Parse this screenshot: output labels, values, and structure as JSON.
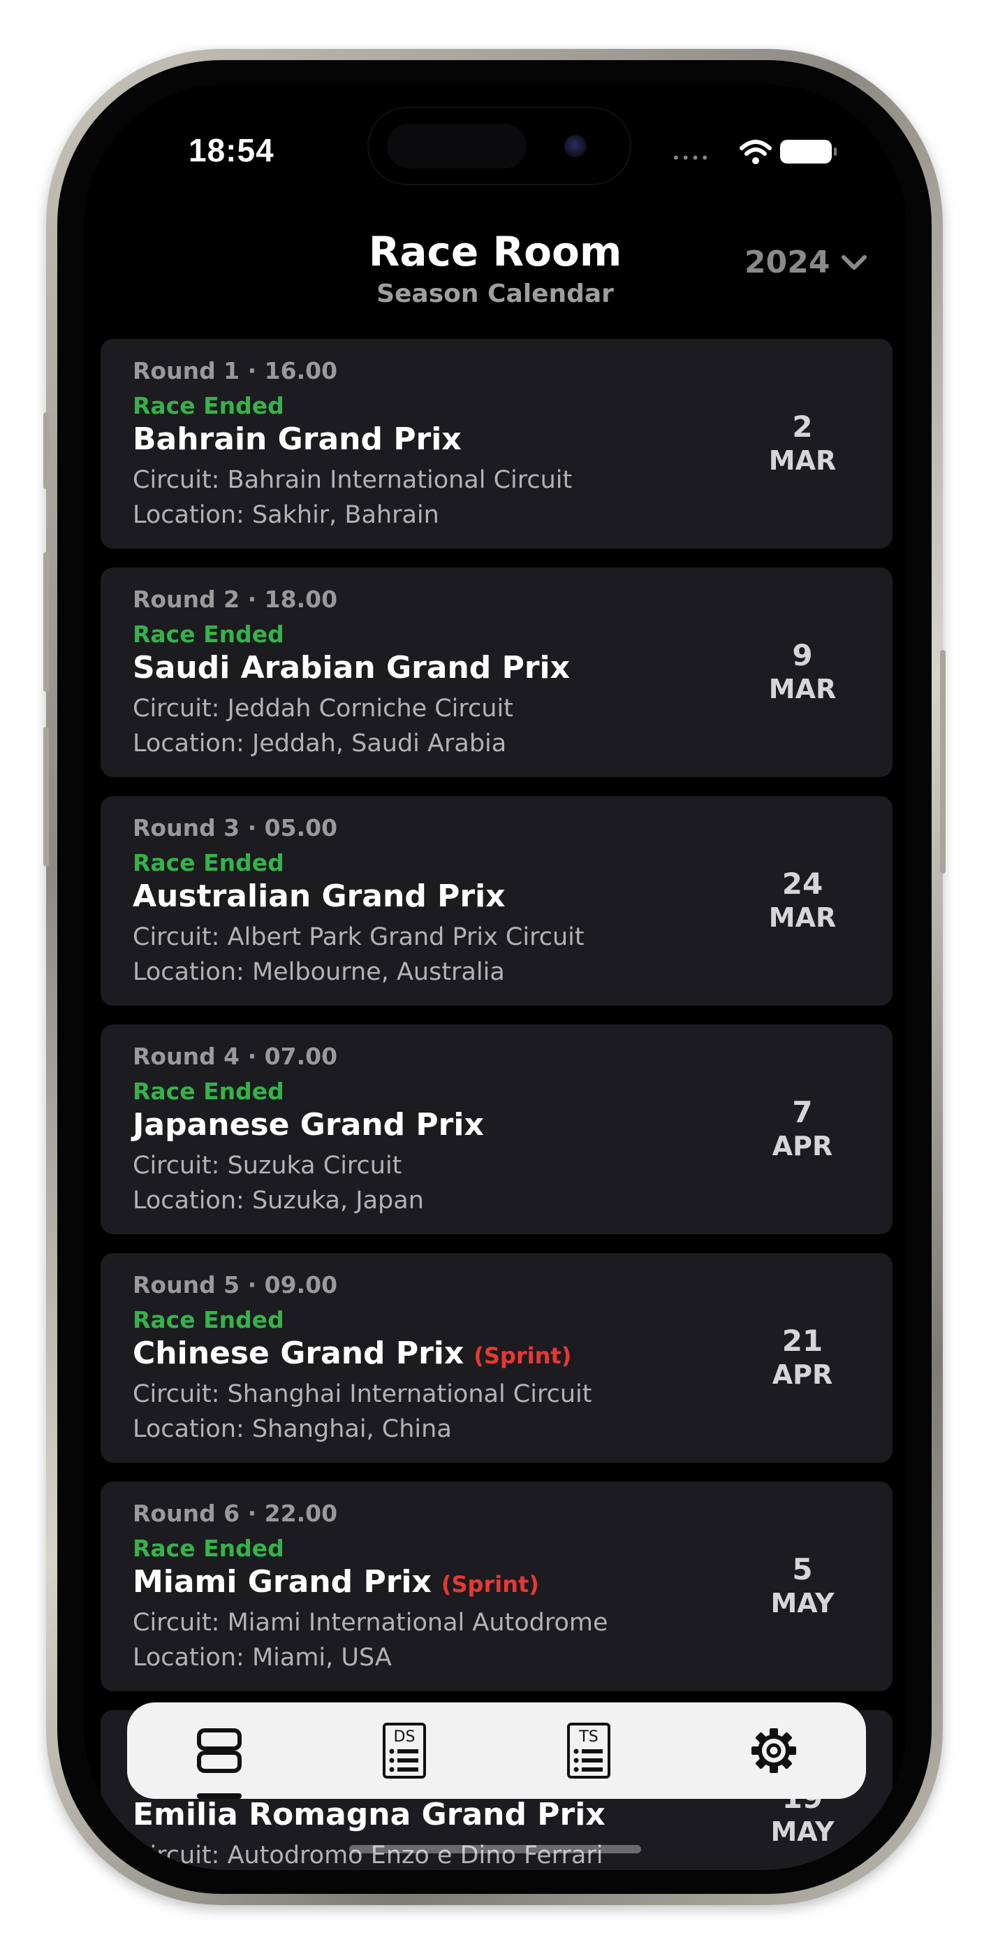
{
  "status_bar": {
    "time": "18:54",
    "signal_dots": "••••"
  },
  "header": {
    "title": "Race Room",
    "subtitle": "Season Calendar",
    "year": "2024"
  },
  "races": [
    {
      "round": "Round 1 · 16.00",
      "status": "Race Ended",
      "name": "Bahrain Grand Prix",
      "sprint": "",
      "circuit": "Circuit: Bahrain International Circuit",
      "location": "Location: Sakhir, Bahrain",
      "day": "2",
      "month": "MAR"
    },
    {
      "round": "Round 2 · 18.00",
      "status": "Race Ended",
      "name": "Saudi Arabian Grand Prix",
      "sprint": "",
      "circuit": "Circuit: Jeddah Corniche Circuit",
      "location": "Location: Jeddah, Saudi Arabia",
      "day": "9",
      "month": "MAR"
    },
    {
      "round": "Round 3 · 05.00",
      "status": "Race Ended",
      "name": "Australian Grand Prix",
      "sprint": "",
      "circuit": "Circuit: Albert Park Grand Prix Circuit",
      "location": "Location: Melbourne, Australia",
      "day": "24",
      "month": "MAR"
    },
    {
      "round": "Round 4 · 07.00",
      "status": "Race Ended",
      "name": "Japanese Grand Prix",
      "sprint": "",
      "circuit": "Circuit: Suzuka Circuit",
      "location": "Location: Suzuka, Japan",
      "day": "7",
      "month": "APR"
    },
    {
      "round": "Round 5 · 09.00",
      "status": "Race Ended",
      "name": "Chinese Grand Prix",
      "sprint": "(Sprint)",
      "circuit": "Circuit: Shanghai International Circuit",
      "location": "Location: Shanghai, China",
      "day": "21",
      "month": "APR"
    },
    {
      "round": "Round 6 · 22.00",
      "status": "Race Ended",
      "name": "Miami Grand Prix",
      "sprint": "(Sprint)",
      "circuit": "Circuit: Miami International Autodrome",
      "location": "Location: Miami, USA",
      "day": "5",
      "month": "MAY"
    },
    {
      "round": "",
      "status": "",
      "name": "Emilia Romagna Grand Prix",
      "sprint": "",
      "circuit": "Circuit: Autodromo Enzo e Dino Ferrari",
      "location": "",
      "day": "19",
      "month": "MAY"
    }
  ],
  "tabbar": {
    "tabs": [
      {
        "icon": "calendar-list-icon"
      },
      {
        "icon": "driver-standings-icon",
        "label": "DS"
      },
      {
        "icon": "team-standings-icon",
        "label": "TS"
      },
      {
        "icon": "gear-icon"
      }
    ]
  },
  "colors": {
    "accent_green": "#35b24a",
    "sprint_red": "#e53935",
    "card_bg": "#1c1b1f"
  }
}
